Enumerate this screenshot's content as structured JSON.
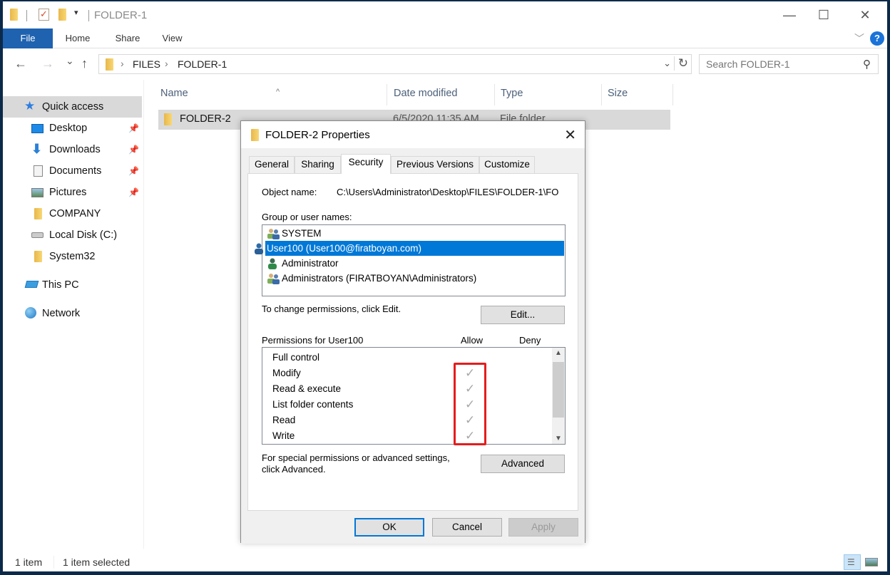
{
  "window": {
    "title": "FOLDER-1",
    "controls": {
      "minimize": "—",
      "maximize": "☐",
      "close": "✕"
    }
  },
  "ribbon": {
    "tabs": [
      "File",
      "Home",
      "Share",
      "View"
    ],
    "help": "?"
  },
  "nav": {
    "back": "←",
    "forward": "→",
    "recent": "⌄",
    "up": "↑",
    "breadcrumb": [
      "FILES",
      "FOLDER-1"
    ],
    "search_placeholder": "Search FOLDER-1"
  },
  "sidebar": {
    "items": [
      {
        "label": "Quick access",
        "icon": "star-icon",
        "pinned": false,
        "selected": true
      },
      {
        "label": "Desktop",
        "icon": "desktop-icon",
        "pinned": true
      },
      {
        "label": "Downloads",
        "icon": "download-icon",
        "pinned": true
      },
      {
        "label": "Documents",
        "icon": "document-icon",
        "pinned": true
      },
      {
        "label": "Pictures",
        "icon": "pictures-icon",
        "pinned": true
      },
      {
        "label": "COMPANY",
        "icon": "folder-icon",
        "pinned": false
      },
      {
        "label": "Local Disk (C:)",
        "icon": "drive-icon",
        "pinned": false
      },
      {
        "label": "System32",
        "icon": "folder-icon",
        "pinned": false
      },
      {
        "label": "This PC",
        "icon": "computer-icon",
        "pinned": false
      },
      {
        "label": "Network",
        "icon": "network-icon",
        "pinned": false
      }
    ]
  },
  "file_list": {
    "columns": [
      "Name",
      "Date modified",
      "Type",
      "Size"
    ],
    "rows": [
      {
        "name": "FOLDER-2",
        "date": "6/5/2020 11:35 AM",
        "type": "File folder",
        "size": ""
      }
    ]
  },
  "status": {
    "count": "1 item",
    "selected": "1 item selected"
  },
  "dialog": {
    "title": "FOLDER-2 Properties",
    "tabs": [
      "General",
      "Sharing",
      "Security",
      "Previous Versions",
      "Customize"
    ],
    "active_tab": "Security",
    "object_name_label": "Object name:",
    "object_name_value": "C:\\Users\\Administrator\\Desktop\\FILES\\FOLDER-1\\FO",
    "group_label": "Group or user names:",
    "users": [
      {
        "name": "SYSTEM",
        "icon": "group-icon",
        "selected": false
      },
      {
        "name": "User100 (User100@firatboyan.com)",
        "icon": "user-icon",
        "selected": true
      },
      {
        "name": "Administrator",
        "icon": "user-icon",
        "selected": false
      },
      {
        "name": "Administrators (FIRATBOYAN\\Administrators)",
        "icon": "group-icon",
        "selected": false
      }
    ],
    "change_text": "To change permissions, click Edit.",
    "edit_button": "Edit...",
    "permissions_label": "Permissions for User100",
    "allow_header": "Allow",
    "deny_header": "Deny",
    "permissions": [
      {
        "name": "Full control",
        "allow": false,
        "deny": false
      },
      {
        "name": "Modify",
        "allow": true,
        "deny": false
      },
      {
        "name": "Read & execute",
        "allow": true,
        "deny": false
      },
      {
        "name": "List folder contents",
        "allow": true,
        "deny": false
      },
      {
        "name": "Read",
        "allow": true,
        "deny": false
      },
      {
        "name": "Write",
        "allow": true,
        "deny": false
      }
    ],
    "advanced_text_1": "For special permissions or advanced settings,",
    "advanced_text_2": "click Advanced.",
    "advanced_button": "Advanced",
    "ok_button": "OK",
    "cancel_button": "Cancel",
    "apply_button": "Apply",
    "check_glyph": "✓",
    "highlight_color": "#e51c1c"
  }
}
